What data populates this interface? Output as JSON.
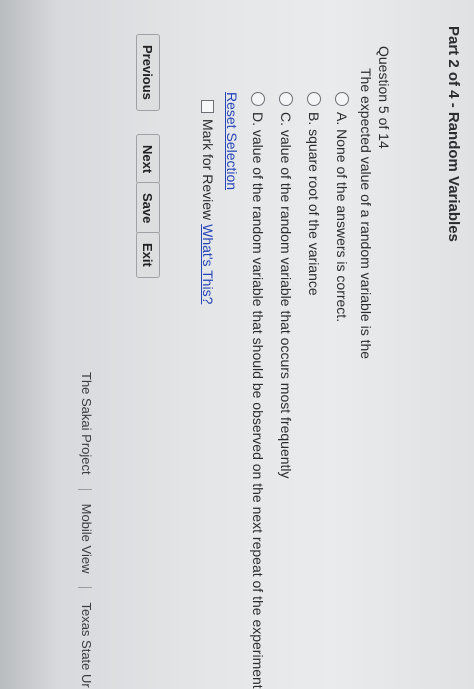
{
  "section_title": "Part 2 of 4 - Random Variables",
  "question": {
    "number": "Question 5 of 14",
    "text": "The expected value of a random variable is the",
    "options": [
      "A. None of the answers is correct.",
      "B. square root of the variance",
      "C. value of the random variable that occurs most frequently",
      "D. value of the random variable that should be observed on the next repeat of the experiment"
    ]
  },
  "reset_label": "Reset Selection",
  "mark_label": "Mark for Review",
  "whats_this_label": "What's This?",
  "buttons": {
    "previous": "Previous",
    "next": "Next",
    "save": "Save",
    "exit": "Exit"
  },
  "footer": {
    "project": "The Sakai Project",
    "mobile": "Mobile View",
    "texas": "Texas State Ur"
  }
}
